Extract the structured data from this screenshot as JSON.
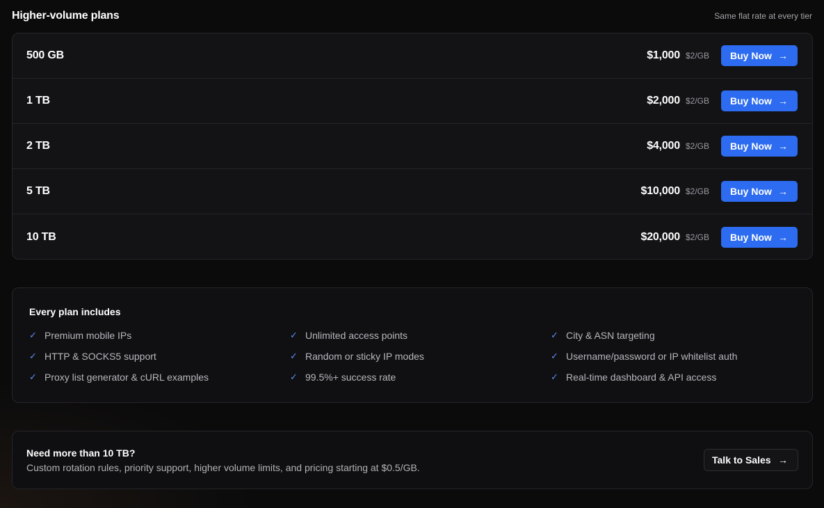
{
  "header": {
    "title": "Higher-volume plans",
    "note": "Same flat rate at every tier"
  },
  "plans": [
    {
      "size": "500 GB",
      "price": "$1,000",
      "rate": "$2/GB",
      "button": "Buy Now"
    },
    {
      "size": "1 TB",
      "price": "$2,000",
      "rate": "$2/GB",
      "button": "Buy Now"
    },
    {
      "size": "2 TB",
      "price": "$4,000",
      "rate": "$2/GB",
      "button": "Buy Now"
    },
    {
      "size": "5 TB",
      "price": "$10,000",
      "rate": "$2/GB",
      "button": "Buy Now"
    },
    {
      "size": "10 TB",
      "price": "$20,000",
      "rate": "$2/GB",
      "button": "Buy Now"
    }
  ],
  "includes": {
    "title": "Every plan includes",
    "features": [
      "Premium mobile IPs",
      "Unlimited access points",
      "City & ASN targeting",
      "HTTP & SOCKS5 support",
      "Random or sticky IP modes",
      "Username/password or IP whitelist auth",
      "Proxy list generator & cURL examples",
      "99.5%+ success rate",
      "Real-time dashboard & API access"
    ]
  },
  "sales": {
    "title": "Need more than 10 TB?",
    "description": "Custom rotation rules, priority support, higher volume limits, and pricing starting at $0.5/GB.",
    "button": "Talk to Sales"
  },
  "icons": {
    "arrow": "arrow-right-icon",
    "check": "check-icon"
  },
  "colors": {
    "accent": "#2d6cf0",
    "check": "#5d8df5",
    "background": "#0b0b0c"
  }
}
